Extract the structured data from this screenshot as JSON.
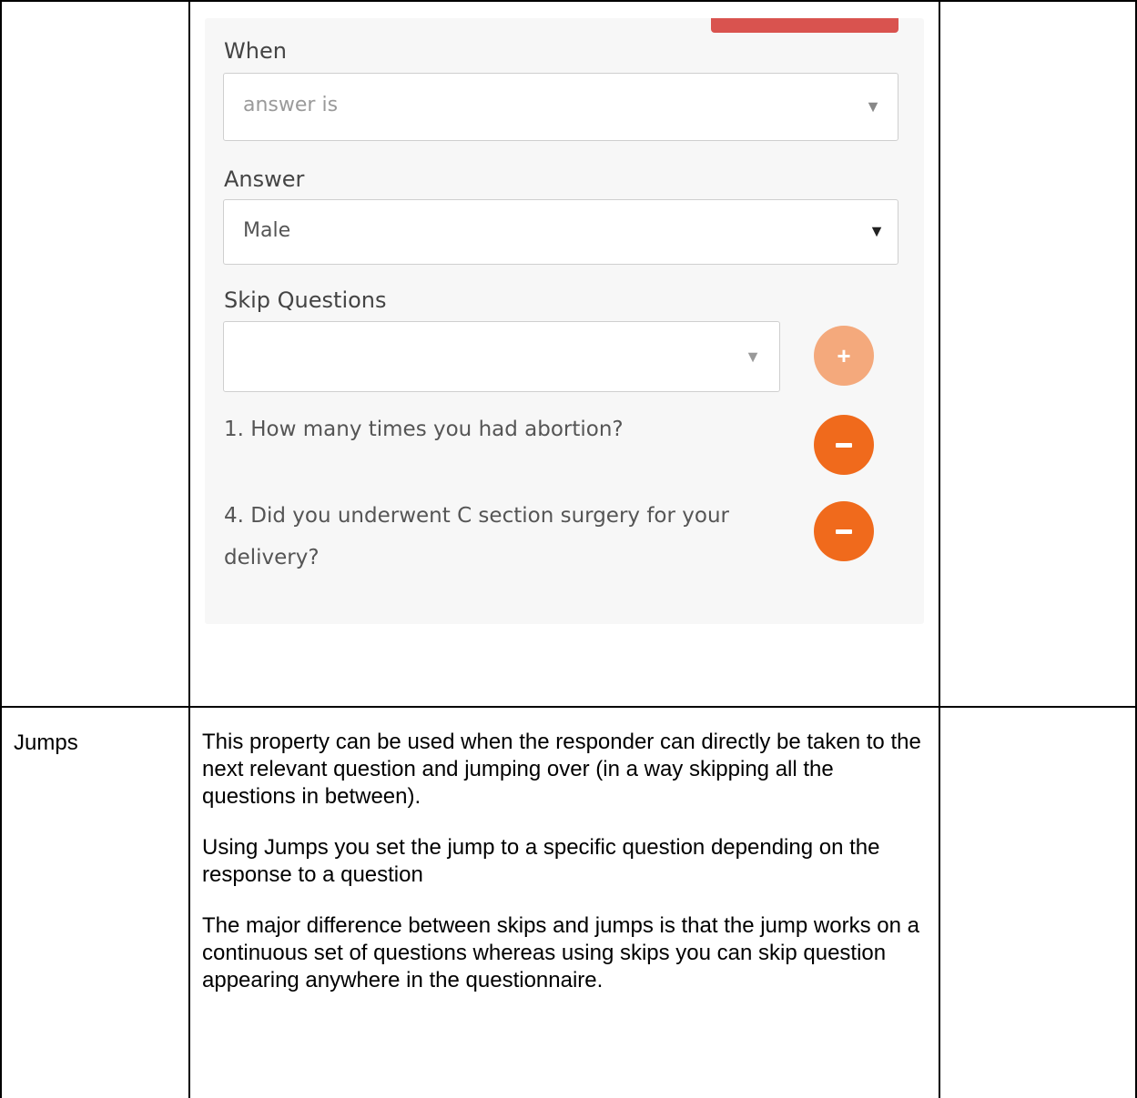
{
  "form": {
    "when_label": "When",
    "when_value": "answer is",
    "answer_label": "Answer",
    "answer_value": "Male",
    "skip_label": "Skip Questions",
    "skip_value": "",
    "add_icon": "plus-icon",
    "remove_icon": "minus-icon",
    "skipped_questions": [
      {
        "text": "1. How many times you had abortion?"
      },
      {
        "text_line1": "4. Did you underwent C section surgery for your",
        "text_line2": "delivery?"
      }
    ]
  },
  "row": {
    "label": "Jumps",
    "paragraphs": [
      "This property can be used when the responder can directly be taken to the next relevant question and jumping over (in a way skipping all the questions in between).",
      "Using Jumps you set the jump to a specific question depending on the response to a question",
      "The major difference between skips and jumps is that the jump works on a continuous set of questions whereas using skips you can skip question appearing anywhere in the questionnaire."
    ]
  },
  "colors": {
    "accent_orange": "#f06a1c",
    "accent_orange_light": "#f4a97c",
    "delete_red": "#d9534f"
  }
}
